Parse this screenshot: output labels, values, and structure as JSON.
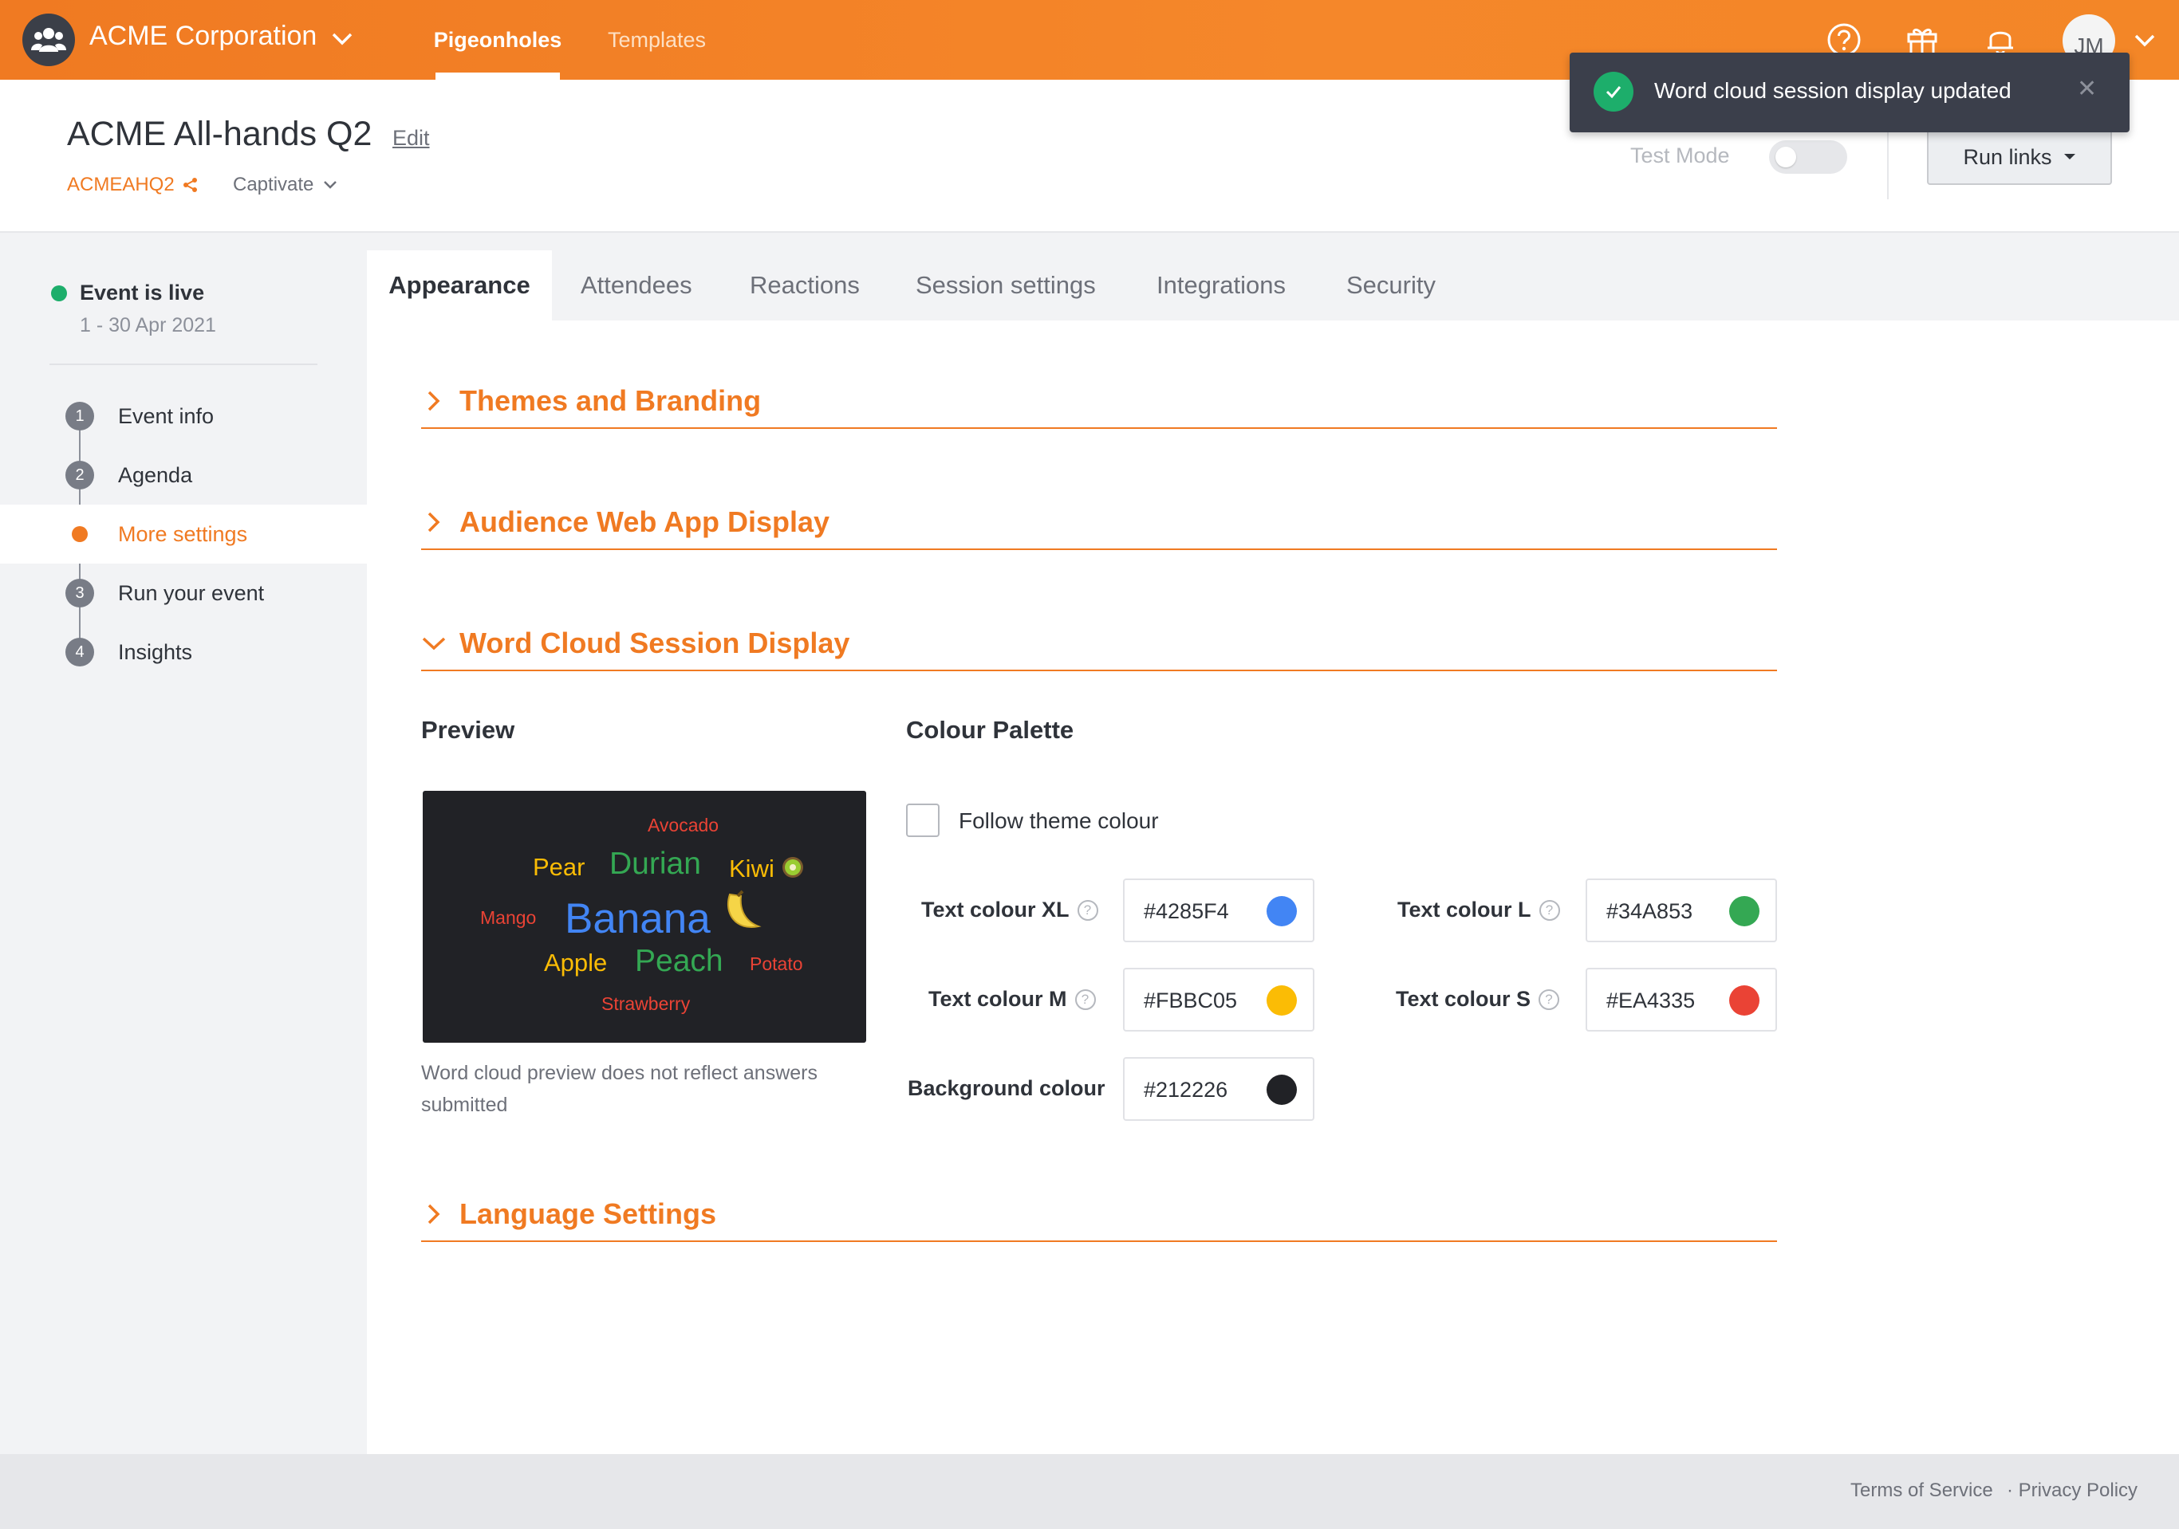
{
  "topbar": {
    "org_name": "ACME Corporation",
    "nav": [
      "Pigeonholes",
      "Templates"
    ],
    "avatar_initials": "JM"
  },
  "toast": {
    "message": "Word cloud session display updated"
  },
  "header": {
    "event_title": "ACME All-hands Q2",
    "edit_label": "Edit",
    "event_code": "ACMEAHQ2",
    "plan": "Captivate",
    "test_mode_label": "Test Mode",
    "test_mode_on": false,
    "run_links_label": "Run links"
  },
  "sidebar": {
    "status": "Event is live",
    "dates": "1 - 30 Apr 2021",
    "items": [
      {
        "num": "1",
        "label": "Event info"
      },
      {
        "num": "2",
        "label": "Agenda"
      },
      {
        "num": "",
        "label": "More settings",
        "active": true
      },
      {
        "num": "3",
        "label": "Run your event"
      },
      {
        "num": "4",
        "label": "Insights"
      }
    ]
  },
  "tabs": [
    "Appearance",
    "Attendees",
    "Reactions",
    "Session settings",
    "Integrations",
    "Security"
  ],
  "sections": {
    "themes": "Themes and Branding",
    "audience": "Audience Web App Display",
    "wordcloud": "Word Cloud Session Display",
    "language": "Language Settings"
  },
  "wordcloud": {
    "preview_title": "Preview",
    "palette_title": "Colour Palette",
    "words": {
      "avocado": "Avocado",
      "pear": "Pear",
      "durian": "Durian",
      "kiwi": "Kiwi",
      "mango": "Mango",
      "banana": "Banana",
      "apple": "Apple",
      "peach": "Peach",
      "potato": "Potato",
      "strawberry": "Strawberry"
    },
    "caption": "Word cloud preview does not reflect answers submitted",
    "follow_theme_label": "Follow theme colour",
    "follow_theme_checked": false,
    "colors": {
      "xl": {
        "label": "Text colour XL",
        "value": "#4285F4"
      },
      "l": {
        "label": "Text colour L",
        "value": "#34A853"
      },
      "m": {
        "label": "Text colour M",
        "value": "#FBBC05"
      },
      "s": {
        "label": "Text colour S",
        "value": "#EA4335"
      },
      "bg": {
        "label": "Background colour",
        "value": "#212226"
      }
    }
  },
  "footer": {
    "terms": "Terms of Service",
    "privacy": "· Privacy Policy"
  },
  "theme": {
    "accent": "#F07A22",
    "live": "#1DAE6B"
  }
}
